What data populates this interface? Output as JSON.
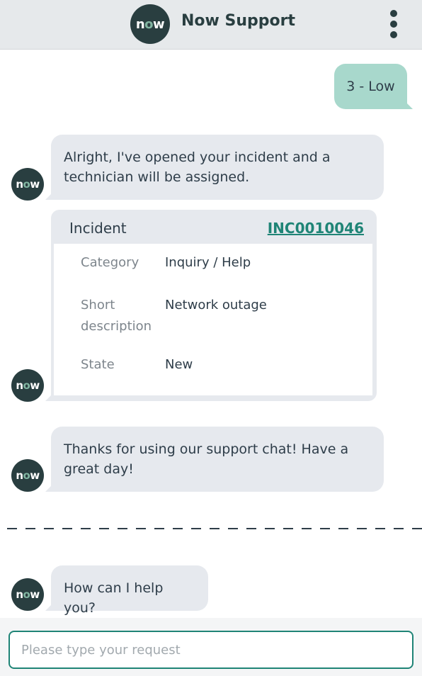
{
  "header": {
    "logo_text_n": "n",
    "logo_text_o": "o",
    "logo_text_w": "w",
    "title": "Now Support"
  },
  "messages": {
    "user_reply": "3 - Low",
    "bot_opened": "Alright, I've opened your incident and a technician will be assigned.",
    "bot_thanks": "Thanks for using our support chat! Have a great day!",
    "bot_help": "How can I help you?"
  },
  "avatar": {
    "text_n": "n",
    "text_o": "o",
    "text_w": "w"
  },
  "incident_card": {
    "title": "Incident",
    "number": "INC0010046",
    "fields": [
      {
        "label": "Category",
        "value": "Inquiry / Help"
      },
      {
        "label": "Short description",
        "value": "Network outage"
      },
      {
        "label": "State",
        "value": "New"
      }
    ]
  },
  "input": {
    "placeholder": "Please type your request",
    "value": ""
  },
  "colors": {
    "brand_dark": "#293e40",
    "brand_accent": "#81b5a1",
    "user_bubble": "#a8d8cc",
    "bot_bubble": "#e6e9ee",
    "link": "#1f8476"
  },
  "icons": {
    "menu": "kebab-menu-icon"
  }
}
